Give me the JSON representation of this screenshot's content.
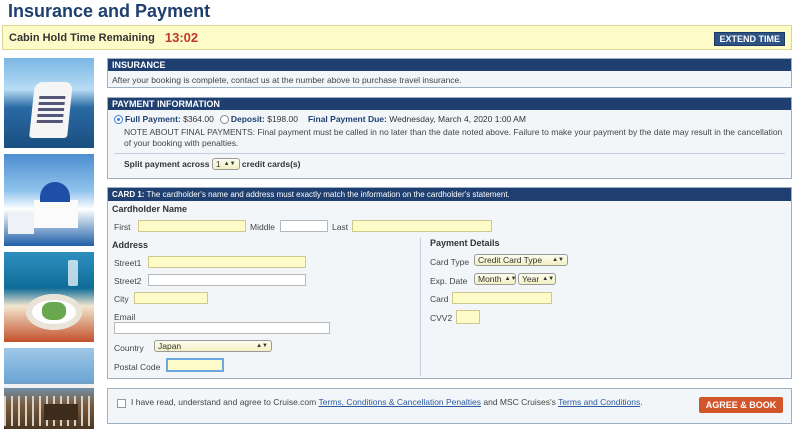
{
  "page": {
    "title": "Insurance and Payment"
  },
  "hold": {
    "label": "Cabin Hold Time Remaining",
    "timer": "13:02",
    "extend_label": "EXTEND TIME"
  },
  "insurance": {
    "header": "INSURANCE",
    "text": "After your booking is complete, contact us at the number above to purchase travel insurance."
  },
  "payment": {
    "header": "PAYMENT INFORMATION",
    "full_label": "Full Payment:",
    "full_amount": "$364.00",
    "deposit_label": "Deposit:",
    "deposit_amount": "$198.00",
    "due_label": "Final Payment Due:",
    "due_date": "Wednesday, March 4, 2020 1:00 AM",
    "note": "NOTE ABOUT FINAL PAYMENTS: Final payment must be called in no later than the date noted above. Failure to make your payment by the date may result in the cancellation of your booking with penalties.",
    "split_prefix": "Split payment across",
    "split_value": "1",
    "split_suffix": "credit cards(s)",
    "selected": "full"
  },
  "card": {
    "header_bold": "CARD 1:",
    "header_text": "The cardholder's name and address must exactly match the information on the cardholder's statement.",
    "cardholder_heading": "Cardholder Name",
    "first_label": "First",
    "middle_label": "Middle",
    "last_label": "Last",
    "address_heading": "Address",
    "street1_label": "Street1",
    "street2_label": "Street2",
    "city_label": "City",
    "email_label": "Email",
    "country_label": "Country",
    "country_value": "Japan",
    "postal_label": "Postal Code",
    "payment_heading": "Payment Details",
    "card_type_label": "Card Type",
    "card_type_value": "Credit Card Type",
    "exp_label": "Exp. Date",
    "exp_month": "Month",
    "exp_year": "Year",
    "card_label": "Card",
    "cvv_label": "CVV2"
  },
  "agree": {
    "prefix": "I have read, understand and agree to Cruise.com",
    "link1": "Terms, Conditions & Cancellation Penalties",
    "middle": "and MSC Cruises's",
    "link2": "Terms and Conditions",
    "suffix": ".",
    "button": "AGREE & BOOK"
  }
}
